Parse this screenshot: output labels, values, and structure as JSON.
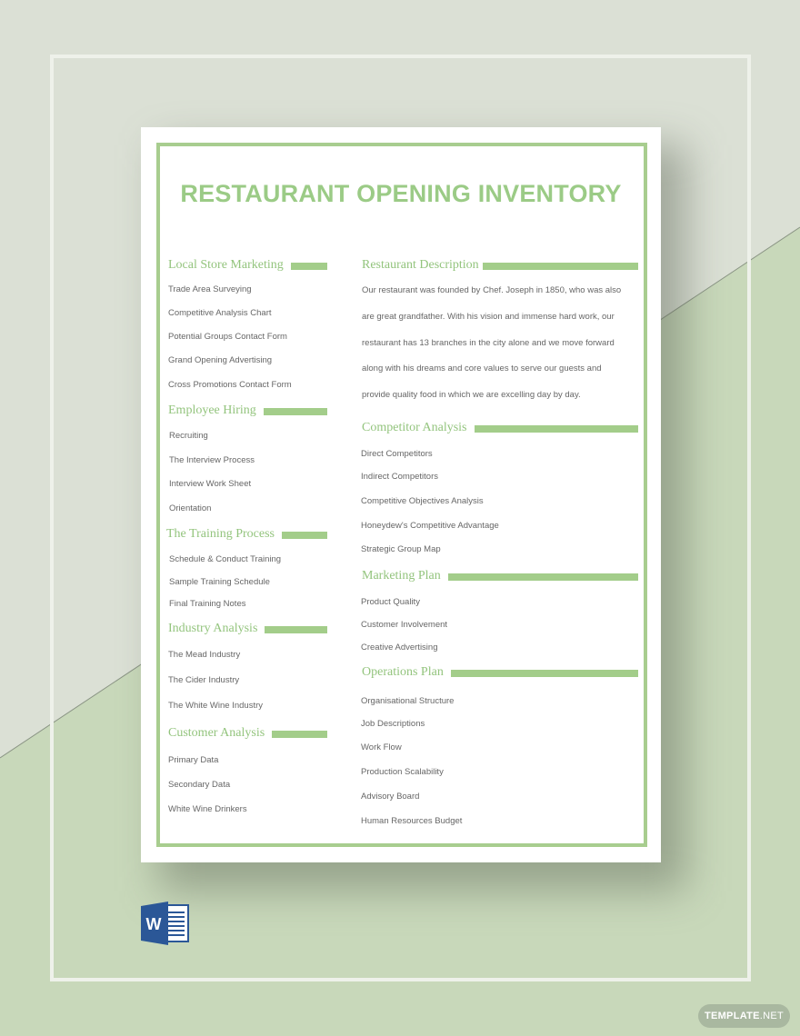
{
  "document": {
    "title": "RESTAURANT OPENING INVENTORY",
    "accent_color": "#9bcb86",
    "left_column": [
      {
        "heading": "Local Store Marketing",
        "items": [
          "Trade Area Surveying",
          "Competitive Analysis Chart",
          "Potential Groups Contact Form",
          "Grand Opening Advertising",
          "Cross Promotions Contact Form"
        ]
      },
      {
        "heading": "Employee Hiring",
        "items": [
          "Recruiting",
          "The Interview Process",
          "Interview Work Sheet",
          "Orientation"
        ]
      },
      {
        "heading": "The Training Process",
        "items": [
          "Schedule & Conduct Training",
          "Sample Training Schedule",
          "Final Training Notes"
        ]
      },
      {
        "heading": "Industry Analysis",
        "items": [
          "The Mead Industry",
          "The Cider Industry",
          "The White Wine Industry"
        ]
      },
      {
        "heading": "Customer Analysis",
        "items": [
          "Primary Data",
          "Secondary Data",
          "White Wine Drinkers"
        ]
      }
    ],
    "right_column": {
      "description": {
        "heading": "Restaurant Description",
        "lines": [
          "Our restaurant was founded by Chef. Joseph in 1850, who was also",
          "are great grandfather. With his vision and immense hard work, our",
          "restaurant has 13 branches in the city alone and we move forward",
          "along with his dreams and core values to serve our guests and",
          "provide quality food in which we are excelling day by day."
        ]
      },
      "sections": [
        {
          "heading": "Competitor Analysis",
          "items": [
            "Direct Competitors",
            "Indirect Competitors",
            "Competitive Objectives Analysis",
            "Honeydew's Competitive Advantage",
            "Strategic Group Map"
          ]
        },
        {
          "heading": "Marketing Plan",
          "items": [
            "Product Quality",
            "Customer Involvement",
            "Creative Advertising"
          ]
        },
        {
          "heading": "Operations Plan",
          "items": [
            "Organisational Structure",
            "Job Descriptions",
            "Work Flow",
            "Production Scalability",
            "Advisory Board",
            "Human Resources Budget"
          ]
        }
      ]
    }
  },
  "file_format_icon": "word-icon",
  "brand": {
    "bold": "TEMPLATE",
    "light": ".NET"
  }
}
